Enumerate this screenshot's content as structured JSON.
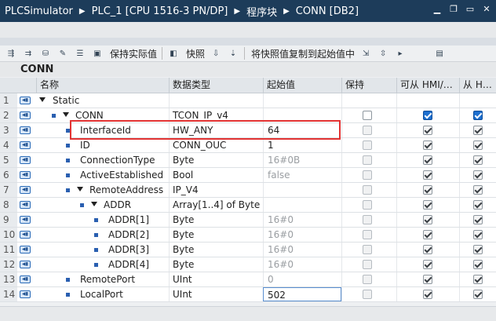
{
  "breadcrumb": [
    "PLCSimulator",
    "PLC_1 [CPU 1516-3 PN/DP]",
    "程序块",
    "CONN [DB2]"
  ],
  "toolbar": {
    "keep_actual": "保持实际值",
    "snapshot": "快照",
    "copy_snapshot": "将快照值复制到起始值中"
  },
  "block_name": "CONN",
  "columns": {
    "name": "名称",
    "datatype": "数据类型",
    "start": "起始值",
    "retain": "保持",
    "hmi_access": "可从 HMI/…",
    "hmi_write": "从 H…"
  },
  "rows": [
    {
      "num": "1",
      "name": "Static",
      "datatype": "",
      "start": "",
      "start_grey": false,
      "retain": "none",
      "hmi1": "none",
      "hmi2": "none"
    },
    {
      "num": "2",
      "name": "CONN",
      "datatype": "TCON_IP_v4",
      "start": "",
      "start_grey": false,
      "retain": "empty",
      "hmi1": "blue",
      "hmi2": "blue"
    },
    {
      "num": "3",
      "name": "InterfaceId",
      "datatype": "HW_ANY",
      "start": "64",
      "start_grey": false,
      "retain": "disabled",
      "hmi1": "checked",
      "hmi2": "checked"
    },
    {
      "num": "4",
      "name": "ID",
      "datatype": "CONN_OUC",
      "start": "1",
      "start_grey": false,
      "retain": "disabled",
      "hmi1": "checked",
      "hmi2": "checked"
    },
    {
      "num": "5",
      "name": "ConnectionType",
      "datatype": "Byte",
      "start": "16#0B",
      "start_grey": true,
      "retain": "disabled",
      "hmi1": "checked",
      "hmi2": "checked"
    },
    {
      "num": "6",
      "name": "ActiveEstablished",
      "datatype": "Bool",
      "start": "false",
      "start_grey": true,
      "retain": "disabled",
      "hmi1": "checked",
      "hmi2": "checked"
    },
    {
      "num": "7",
      "name": "RemoteAddress",
      "datatype": "IP_V4",
      "start": "",
      "start_grey": false,
      "retain": "disabled",
      "hmi1": "checked",
      "hmi2": "checked"
    },
    {
      "num": "8",
      "name": "ADDR",
      "datatype": "Array[1..4] of Byte",
      "start": "",
      "start_grey": false,
      "retain": "disabled",
      "hmi1": "checked",
      "hmi2": "checked"
    },
    {
      "num": "9",
      "name": "ADDR[1]",
      "datatype": "Byte",
      "start": "16#0",
      "start_grey": true,
      "retain": "disabled",
      "hmi1": "checked",
      "hmi2": "checked"
    },
    {
      "num": "10",
      "name": "ADDR[2]",
      "datatype": "Byte",
      "start": "16#0",
      "start_grey": true,
      "retain": "disabled",
      "hmi1": "checked",
      "hmi2": "checked"
    },
    {
      "num": "11",
      "name": "ADDR[3]",
      "datatype": "Byte",
      "start": "16#0",
      "start_grey": true,
      "retain": "disabled",
      "hmi1": "checked",
      "hmi2": "checked"
    },
    {
      "num": "12",
      "name": "ADDR[4]",
      "datatype": "Byte",
      "start": "16#0",
      "start_grey": true,
      "retain": "disabled",
      "hmi1": "checked",
      "hmi2": "checked"
    },
    {
      "num": "13",
      "name": "RemotePort",
      "datatype": "UInt",
      "start": "0",
      "start_grey": true,
      "retain": "disabled",
      "hmi1": "checked",
      "hmi2": "checked"
    },
    {
      "num": "14",
      "name": "LocalPort",
      "datatype": "UInt",
      "start": "502",
      "start_grey": false,
      "retain": "disabled",
      "hmi1": "checked",
      "hmi2": "checked"
    }
  ]
}
